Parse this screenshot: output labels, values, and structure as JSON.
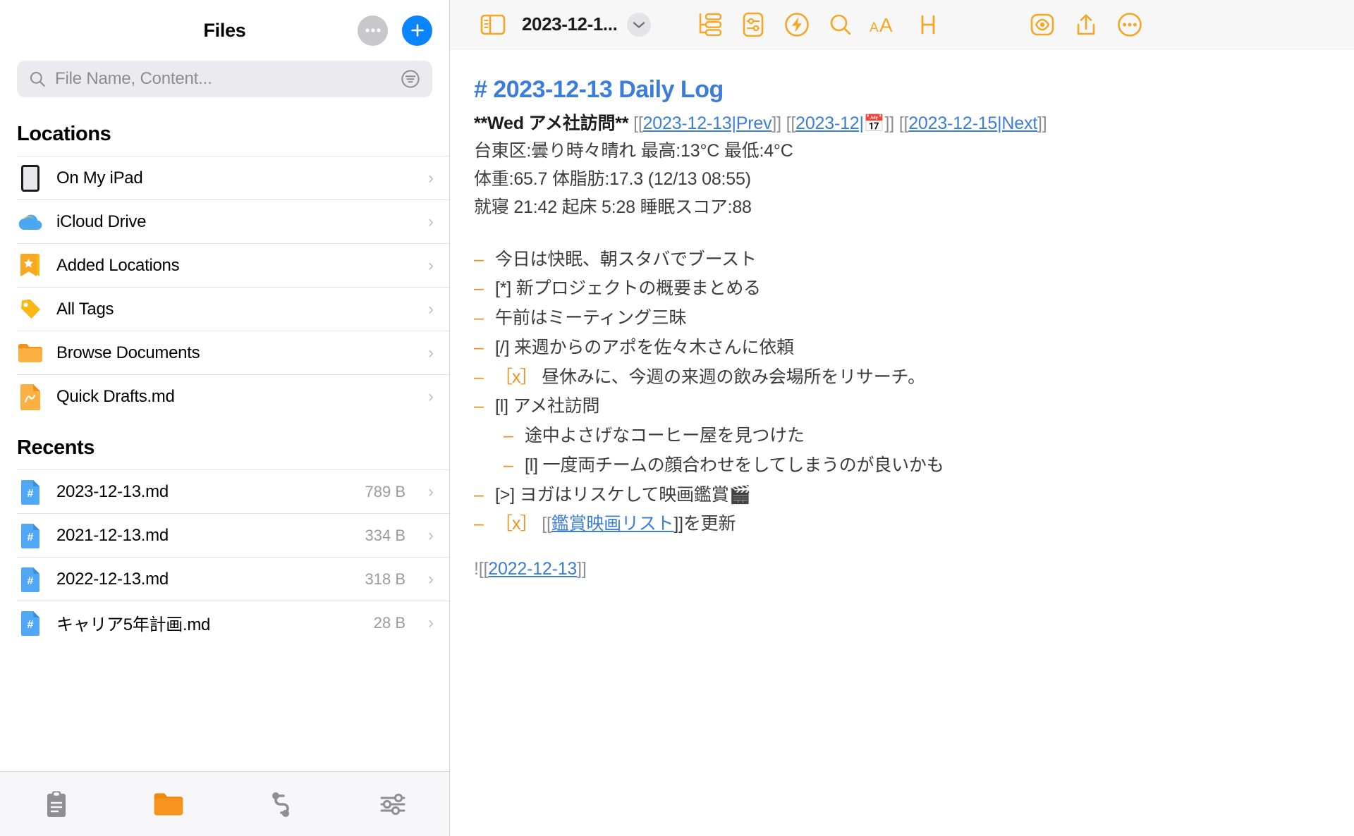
{
  "sidebar": {
    "title": "Files",
    "more_button": "more-horizontal",
    "add_button": "plus",
    "search": {
      "placeholder": "File Name, Content...",
      "icon": "search-icon",
      "filter_icon": "filter-icon"
    },
    "locations": {
      "heading": "Locations",
      "items": [
        {
          "label": "On My iPad",
          "icon": "ipad-icon",
          "chevron": "›"
        },
        {
          "label": "iCloud Drive",
          "icon": "icloud-icon",
          "chevron": "›"
        },
        {
          "label": "Added Locations",
          "icon": "bookmark-star-icon",
          "chevron": "›"
        },
        {
          "label": "All Tags",
          "icon": "tag-icon",
          "chevron": "›"
        },
        {
          "label": "Browse Documents",
          "icon": "folder-icon",
          "chevron": "›"
        },
        {
          "label": "Quick Drafts.md",
          "icon": "draft-file-icon",
          "chevron": "›"
        }
      ]
    },
    "recents": {
      "heading": "Recents",
      "items": [
        {
          "label": "2023-12-13.md",
          "size": "789 B",
          "icon": "markdown-file-icon",
          "chevron": "›"
        },
        {
          "label": "2021-12-13.md",
          "size": "334 B",
          "icon": "markdown-file-icon",
          "chevron": "›"
        },
        {
          "label": "2022-12-13.md",
          "size": "318 B",
          "icon": "markdown-file-icon",
          "chevron": "›"
        },
        {
          "label": "キャリア5年計画.md",
          "size": "28 B",
          "icon": "markdown-file-icon",
          "chevron": "›"
        }
      ]
    },
    "tabbar": [
      {
        "name": "clipboard-tab",
        "icon": "clipboard-icon",
        "active": false
      },
      {
        "name": "files-tab",
        "icon": "folder-icon",
        "active": true
      },
      {
        "name": "workflow-tab",
        "icon": "nodes-icon",
        "active": false
      },
      {
        "name": "settings-tab",
        "icon": "sliders-icon",
        "active": false
      }
    ]
  },
  "editor": {
    "toolbar": {
      "sidebar_toggle": "sidebar-toggle-icon",
      "doc_title": "2023-12-1...",
      "title_chevron": "chevron-down-icon",
      "outline": "outline-icon",
      "document_settings": "document-settings-icon",
      "actions": "lightning-icon",
      "search": "search-icon",
      "text_size": "aA",
      "heading": "H",
      "preview": "eye-preview-icon",
      "share": "share-icon",
      "more": "more-circle-icon"
    },
    "document": {
      "heading": "# 2023-12-13 Daily Log",
      "nav_line": {
        "bold": "**Wed アメ社訪問**",
        "prev_open": " [[",
        "prev_link": "2023-12-13|Prev",
        "prev_close": "]] ",
        "cal_open": "[[",
        "cal_link": "2023-12|",
        "cal_emoji": "📅",
        "cal_close": "]] ",
        "next_open": "[[",
        "next_link": "2023-12-15|Next",
        "next_close": "]]"
      },
      "weather": "台東区:曇り時々晴れ 最高:13°C 最低:4°C",
      "body_stats": "体重:65.7 体脂肪:17.3 (12/13 08:55)",
      "sleep": "就寝 21:42 起床 5:28 睡眠スコア:88",
      "list": [
        {
          "dash": "–",
          "indent": 0,
          "marker": "",
          "text": "今日は快眠、朝スタバでブースト"
        },
        {
          "dash": "–",
          "indent": 0,
          "marker": "[*]",
          "text": " 新プロジェクトの概要まとめる"
        },
        {
          "dash": "–",
          "indent": 0,
          "marker": "",
          "text": "午前はミーティング三昧"
        },
        {
          "dash": "–",
          "indent": 0,
          "marker": "[/]",
          "text": " 来週からのアポを佐々木さんに依頼"
        },
        {
          "dash": "–",
          "indent": 0,
          "marker": "［x］",
          "marker_style": "check",
          "text": " 昼休みに、今週の来週の飲み会場所をリサーチ。"
        },
        {
          "dash": "–",
          "indent": 0,
          "marker": "[l]",
          "text": " アメ社訪問"
        },
        {
          "dash": "–",
          "indent": 1,
          "marker": "",
          "text": "途中よさげなコーヒー屋を見つけた"
        },
        {
          "dash": "–",
          "indent": 1,
          "marker": "[l]",
          "text": " 一度両チームの顔合わせをしてしまうのが良いかも"
        },
        {
          "dash": "–",
          "indent": 0,
          "marker": "[>]",
          "text": " ヨガはリスケして映画鑑賞🎬"
        }
      ],
      "last_item": {
        "dash": "–",
        "marker": "［x］",
        "open": "  [[",
        "link": "鑑賞映画リスト",
        "close": "]]を更新"
      },
      "embed_line": {
        "prefix": "![[",
        "link": "2022-12-13",
        "suffix": "]]"
      }
    }
  },
  "colors": {
    "accent_orange": "#f5a623",
    "link_blue": "#3b7dd8",
    "tint_blue": "#0a84ff",
    "text_grey": "#3c3c3e",
    "bracket_grey": "#8e8e93"
  }
}
